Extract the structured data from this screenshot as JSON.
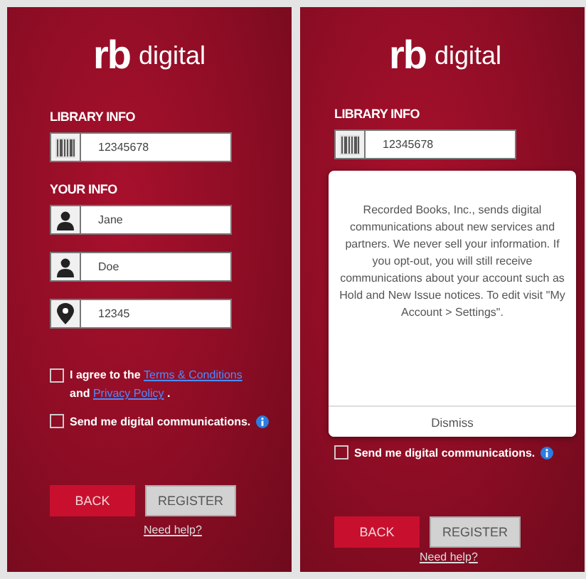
{
  "screens": [
    {
      "logo": {
        "mark": "rb",
        "word": "digital"
      },
      "library_label": "LIBRARY INFO",
      "library_field": {
        "kind": "barcode",
        "value": "12345678"
      },
      "your_info_label": "YOUR INFO",
      "fields": [
        {
          "kind": "person",
          "value": "Jane"
        },
        {
          "kind": "person",
          "value": "Doe"
        },
        {
          "kind": "pin",
          "value": "12345"
        }
      ],
      "agreement": {
        "checked": false,
        "before": "I agree to the",
        "terms_link": "Terms & Conditions",
        "middle": "and",
        "privacy_link": "Privacy Policy",
        "after": "."
      },
      "communications": {
        "checked": false,
        "label": "Send me digital communications."
      },
      "buttons": [
        {
          "kind": "primary",
          "label": "BACK"
        },
        {
          "kind": "secondary",
          "label": "REGISTER"
        }
      ],
      "help_link": "Need help?"
    },
    {
      "logo": {
        "mark": "rb",
        "word": "digital"
      },
      "library_label": "LIBRARY INFO",
      "library_field": {
        "kind": "barcode",
        "value": "12345678"
      },
      "popup": {
        "text": "Recorded Books, Inc., sends digital communications about new services and partners. We never sell your information. If you opt-out, you will still receive communications about your account such as Hold and New Issue notices. To edit visit \"My Account > Settings\".",
        "button": "Dismiss"
      },
      "communications": {
        "checked": false,
        "label": "Send me digital communications."
      },
      "buttons": [
        {
          "kind": "primary",
          "label": "BACK"
        },
        {
          "kind": "secondary",
          "label": "REGISTER"
        }
      ],
      "help_link": "Need help?"
    }
  ]
}
